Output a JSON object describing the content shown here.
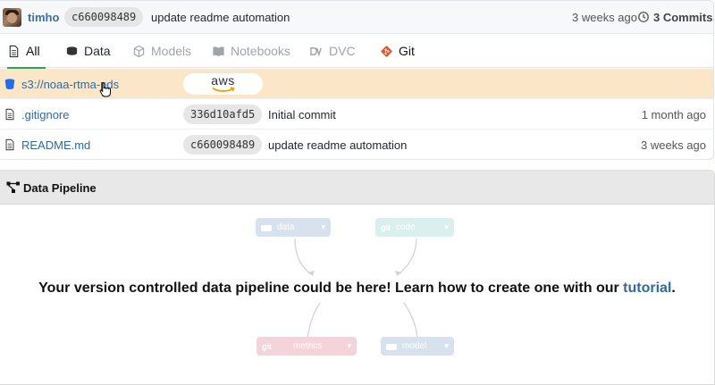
{
  "commit_bar": {
    "user": "timho",
    "hash": "c660098489",
    "message": "update readme automation",
    "time": "3 weeks ago",
    "commits_label": "3 Commits"
  },
  "tabs": [
    {
      "label": "All",
      "icon": "file-icon",
      "state": "active"
    },
    {
      "label": "Data",
      "icon": "database-icon",
      "state": "enabled"
    },
    {
      "label": "Models",
      "icon": "cube-icon",
      "state": "disabled"
    },
    {
      "label": "Notebooks",
      "icon": "book-icon",
      "state": "disabled"
    },
    {
      "label": "DVC",
      "icon": "dvc-icon",
      "state": "disabled"
    },
    {
      "label": "Git",
      "icon": "git-icon",
      "state": "enabled"
    }
  ],
  "files": [
    {
      "name": "s3://noaa-rtma-pds",
      "icon": "bucket-icon",
      "badge": "aws",
      "highlight": true
    },
    {
      "name": ".gitignore",
      "icon": "file-icon",
      "hash": "336d10afd5",
      "message": "Initial commit",
      "time": "1 month ago"
    },
    {
      "name": "README.md",
      "icon": "file-icon",
      "hash": "c660098489",
      "message": "update readme automation",
      "time": "3 weeks ago"
    }
  ],
  "pipeline": {
    "title": "Data Pipeline",
    "nodes": {
      "data": {
        "tag": "",
        "label": "data"
      },
      "code": {
        "tag": "git",
        "label": "code"
      },
      "metrics": {
        "tag": "git",
        "label": "metrics"
      },
      "model": {
        "tag": "",
        "label": "model"
      }
    },
    "message_main": "Your version controlled data pipeline could be here! Learn how to create one with our ",
    "message_link": "tutorial",
    "message_end": "."
  },
  "colors": {
    "link": "#2f6aa3",
    "highlight_row": "#fbe6c8",
    "active_tab_underline": "#2ea44f",
    "git_orange": "#e8542d"
  }
}
